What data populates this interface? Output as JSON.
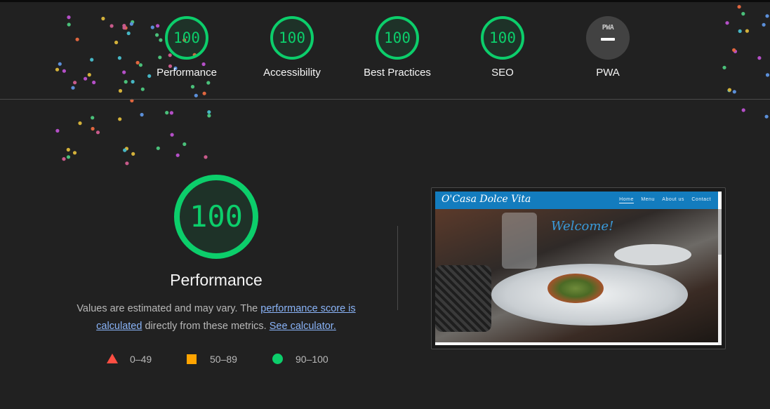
{
  "header": {
    "gauges": [
      {
        "label": "Performance",
        "score": "100"
      },
      {
        "label": "Accessibility",
        "score": "100"
      },
      {
        "label": "Best Practices",
        "score": "100"
      },
      {
        "label": "SEO",
        "score": "100"
      },
      {
        "label": "PWA",
        "badge": "PWA",
        "score": "—"
      }
    ]
  },
  "main": {
    "score": "100",
    "title": "Performance",
    "description": {
      "part1": "Values are estimated and may vary. The ",
      "link1": "performance score is calculated",
      "part2": " directly from these metrics. ",
      "link2": "See calculator."
    },
    "legend": [
      {
        "range": "0–49",
        "color": "#ff4e42",
        "shape": "triangle"
      },
      {
        "range": "50–89",
        "color": "#ffa400",
        "shape": "square"
      },
      {
        "range": "90–100",
        "color": "#0cce6b",
        "shape": "circle"
      }
    ]
  },
  "screenshot": {
    "site_title": "O'Casa Dolce Vita",
    "nav": [
      "Home",
      "Menu",
      "About us",
      "Contact"
    ],
    "hero_text": "Welcome!"
  },
  "colors": {
    "pass": "#0cce6b",
    "average": "#ffa400",
    "fail": "#ff4e42",
    "background": "#212121",
    "link": "#8ab4f8"
  }
}
